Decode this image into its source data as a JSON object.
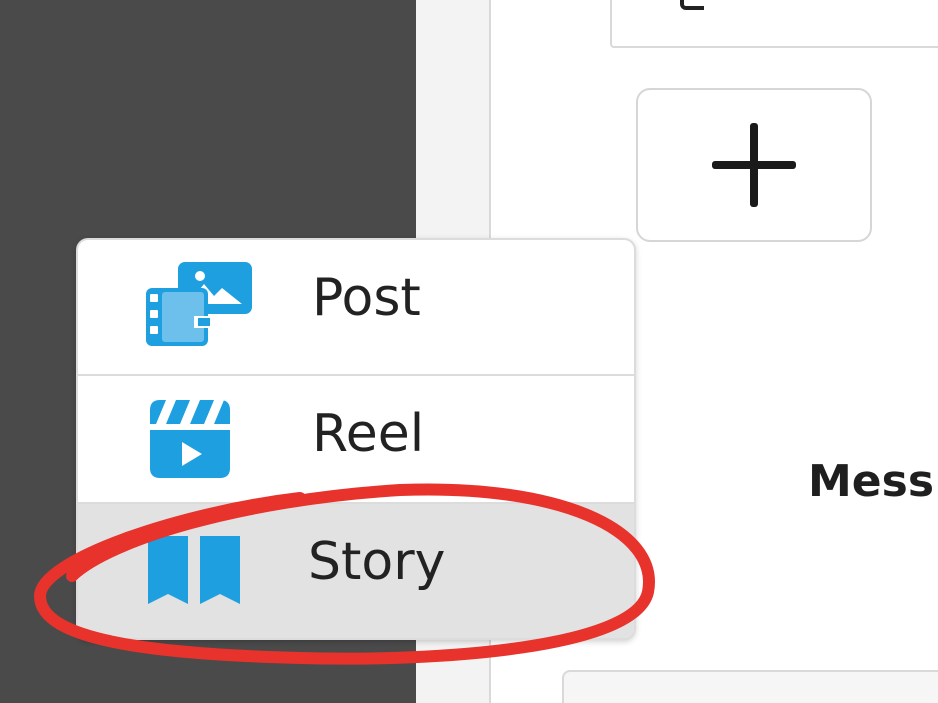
{
  "menu": {
    "items": [
      {
        "label": "Post",
        "icon": "post-media-icon"
      },
      {
        "label": "Reel",
        "icon": "reel-clapper-icon"
      },
      {
        "label": "Story",
        "icon": "story-book-icon"
      }
    ],
    "highlighted_index": 2
  },
  "add_button": {
    "icon": "plus-icon"
  },
  "main": {
    "messages_label": "Mess"
  },
  "colors": {
    "sidebar": "#4a4a4a",
    "icon_blue": "#1e9fe0",
    "highlight_row": "#e2e2e2",
    "annotation_red": "#e8322c"
  }
}
